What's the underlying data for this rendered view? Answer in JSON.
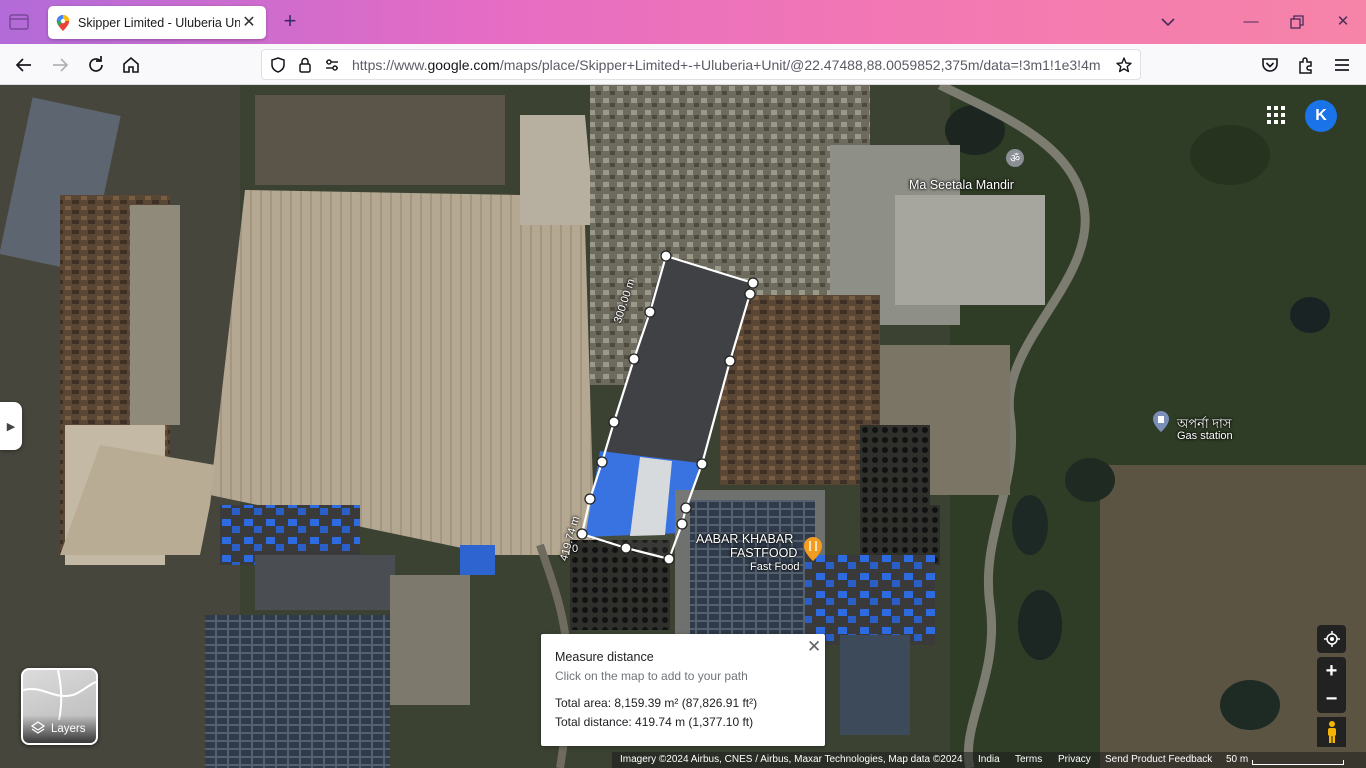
{
  "browser": {
    "tab_title": "Skipper Limited - Uluberia Unit",
    "url_prefix": "https://www.",
    "url_domain": "google.com",
    "url_rest": "/maps/place/Skipper+Limited+-+Uluberia+Unit/@22.47488,88.0059852,375m/data=!3m1!1e3!4m"
  },
  "map": {
    "avatar_letter": "K",
    "places": {
      "temple": "Ma Seetala Mandir",
      "gas_name": "অপর্না দাস",
      "gas_type": "Gas station",
      "food_name_line1": "AABAR KHABAR",
      "food_name_line2": "FASTFOOD",
      "food_type": "Fast Food"
    },
    "measure_labels": {
      "edge_length": "300.00 m",
      "total_length": "419.74 m",
      "zero": "0"
    },
    "layers_label": "Layers",
    "measure_card": {
      "title": "Measure distance",
      "subtitle": "Click on the map to add to your path",
      "total_area": "Total area: 8,159.39 m² (87,826.91 ft²)",
      "total_distance": "Total distance: 419.74 m (1,377.10 ft)"
    },
    "attribution": {
      "imagery": "Imagery ©2024 Airbus, CNES / Airbus, Maxar Technologies, Map data ©2024",
      "country": "India",
      "terms": "Terms",
      "privacy": "Privacy",
      "feedback": "Send Product Feedback",
      "scale": "50 m"
    }
  },
  "colors": {
    "tab_gradient_start": "#b26bd8",
    "tab_gradient_end": "#f684a8",
    "google_blue": "#1a73e8",
    "blue_roof": "#2f6be0",
    "factory_roof": "#b9ac97"
  }
}
